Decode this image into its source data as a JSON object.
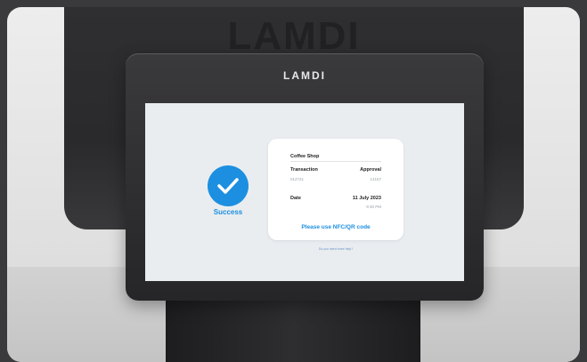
{
  "brand": {
    "rear_logo": "LAMDI",
    "device_logo": "LAMDI"
  },
  "screen": {
    "status_label": "Success",
    "receipt": {
      "shop": "Coffee Shop",
      "transaction_label": "Transaction",
      "transaction_value": "012721",
      "approval_label": "Approval",
      "approval_value": "14157",
      "date_label": "Date",
      "date_value": "11 July 2023",
      "time_value": "9:30 PM",
      "prompt": "Please use NFC/QR code"
    },
    "help_link": "Do you need more help?"
  },
  "colors": {
    "accent": "#1c8fe0",
    "screen_bg": "#e9edf0",
    "device_body": "#2e2e30"
  },
  "icons": {
    "status_icon": "check-circle-icon"
  }
}
